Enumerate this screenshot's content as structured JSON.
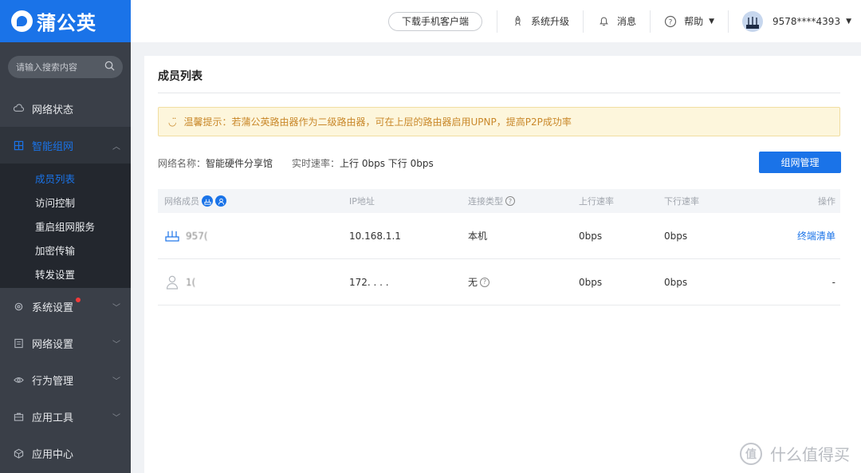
{
  "brand": {
    "name": "蒲公英"
  },
  "sidebar": {
    "search_placeholder": "请输入搜索内容",
    "items": [
      {
        "label": "网络状态",
        "icon": "cloud-icon"
      },
      {
        "label": "智能组网",
        "icon": "network-icon",
        "expanded": true
      },
      {
        "label": "系统设置",
        "icon": "gear-icon",
        "has_notification": true
      },
      {
        "label": "网络设置",
        "icon": "doc-icon"
      },
      {
        "label": "行为管理",
        "icon": "eye-icon"
      },
      {
        "label": "应用工具",
        "icon": "toolbox-icon"
      },
      {
        "label": "应用中心",
        "icon": "cube-icon"
      }
    ],
    "submenu": [
      {
        "label": "成员列表",
        "active": true
      },
      {
        "label": "访问控制"
      },
      {
        "label": "重启组网服务"
      },
      {
        "label": "加密传输"
      },
      {
        "label": "转发设置"
      }
    ]
  },
  "topbar": {
    "download_label": "下载手机客户端",
    "upgrade_label": "系统升级",
    "messages_label": "消息",
    "help_label": "帮助",
    "account": "9578****4393"
  },
  "main": {
    "title": "成员列表",
    "tip": "温馨提示：若蒲公英路由器作为二级路由器，可在上层的路由器启用UPNP，提高P2P成功率",
    "network_name_label": "网络名称：",
    "network_name": "智能硬件分享馆",
    "speed_label": "实时速率：",
    "speed_value": "上行 0bps 下行 0bps",
    "manage_button": "组网管理",
    "columns": [
      "网络成员",
      "IP地址",
      "连接类型",
      "上行速率",
      "下行速率",
      "操作"
    ],
    "rows": [
      {
        "member": "957( ",
        "ip": "10.168.1.1",
        "type": "本机",
        "up": "0bps",
        "down": "0bps",
        "action": "终端清单"
      },
      {
        "member": "1(",
        "ip": "172. . . .",
        "type": "无",
        "up": "0bps",
        "down": "0bps",
        "action": "-"
      }
    ]
  },
  "watermark": {
    "text": "什么值得买",
    "logo": "值"
  }
}
